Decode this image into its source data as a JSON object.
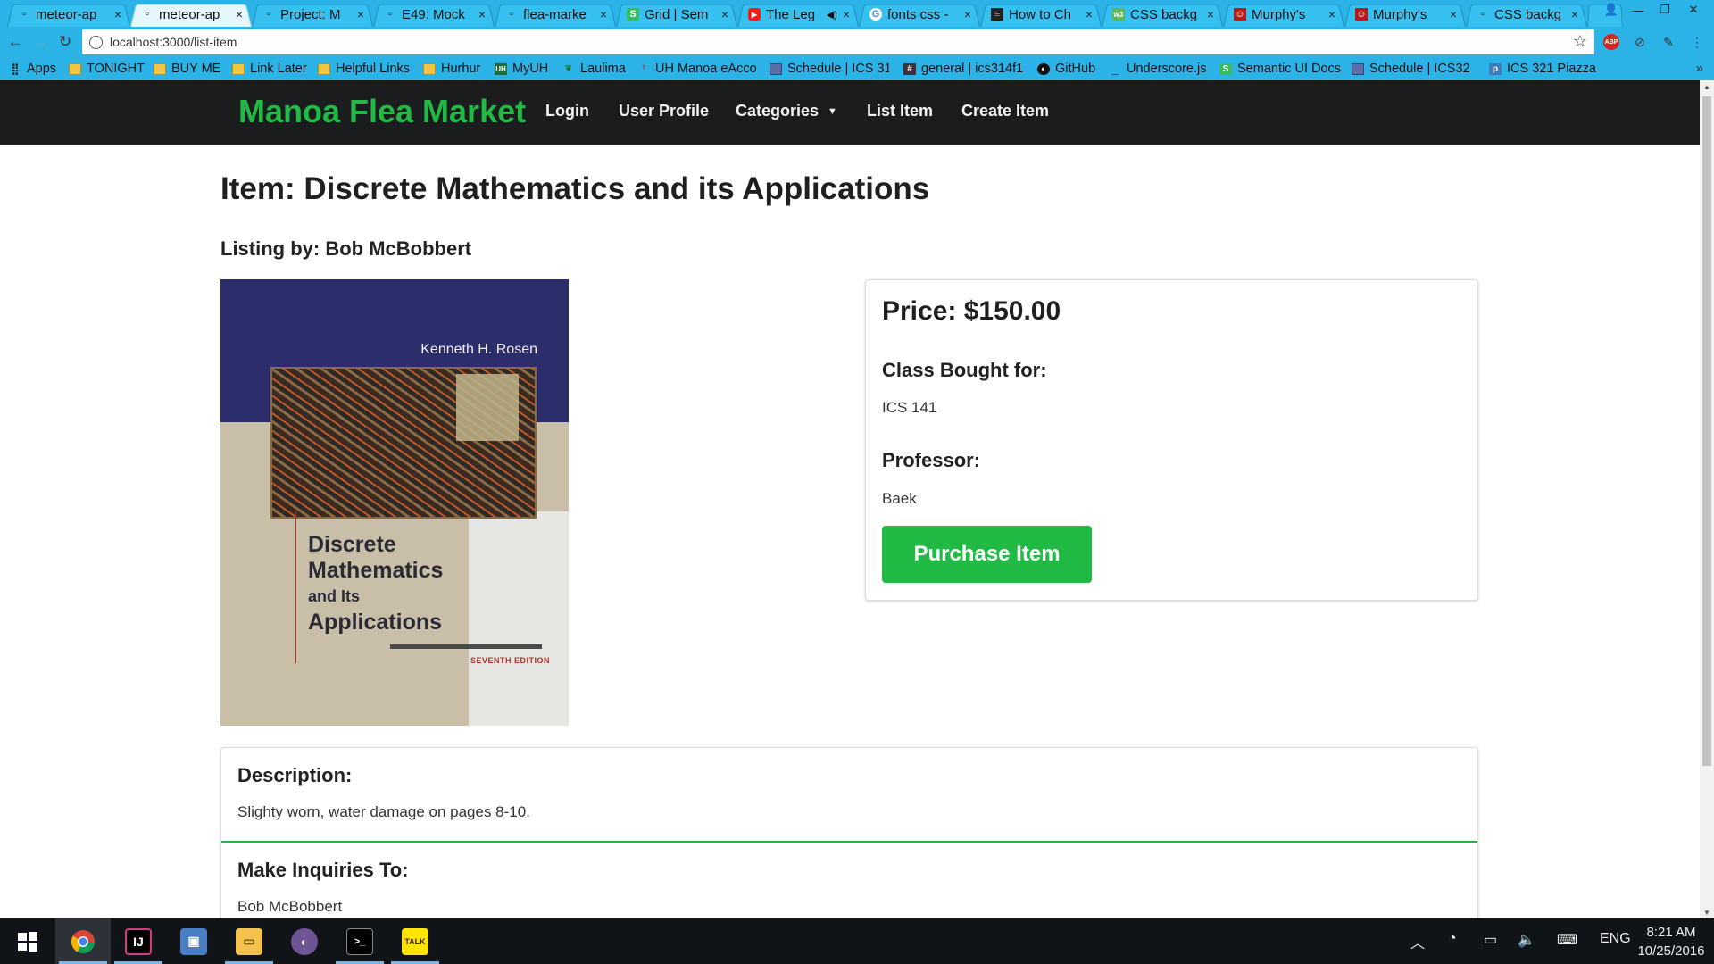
{
  "browser": {
    "tabs": [
      {
        "title": "meteor-ap",
        "icon": "page-icon",
        "active": false
      },
      {
        "title": "meteor-ap",
        "icon": "page-icon",
        "active": true
      },
      {
        "title": "Project: M",
        "icon": "page-icon",
        "active": false
      },
      {
        "title": "E49: Mock",
        "icon": "page-icon",
        "active": false
      },
      {
        "title": "flea-marke",
        "icon": "page-icon",
        "active": false
      },
      {
        "title": "Grid | Sem",
        "icon": "semantic-icon",
        "active": false
      },
      {
        "title": "The Leg",
        "icon": "youtube-icon",
        "active": false
      },
      {
        "title": "fonts css -",
        "icon": "google-icon",
        "active": false
      },
      {
        "title": "How to Ch",
        "icon": "stackoverflow-icon",
        "active": false
      },
      {
        "title": "CSS backg",
        "icon": "w3schools-icon",
        "active": false
      },
      {
        "title": "Murphy's",
        "icon": "murphy-icon",
        "active": false
      },
      {
        "title": "Murphy's",
        "icon": "murphy-icon",
        "active": false
      },
      {
        "title": "CSS backg",
        "icon": "page-icon",
        "active": false
      }
    ],
    "url": "localhost:3000/list-item",
    "bookmarks": [
      {
        "label": "Apps",
        "icon": "apps-grid-icon"
      },
      {
        "label": "TONIGHT",
        "icon": "folder-icon"
      },
      {
        "label": "BUY ME",
        "icon": "folder-icon"
      },
      {
        "label": "Link Later",
        "icon": "folder-icon"
      },
      {
        "label": "Helpful Links",
        "icon": "folder-icon"
      },
      {
        "label": "Hurhur",
        "icon": "folder-icon"
      },
      {
        "label": "MyUH",
        "icon": "uh-icon"
      },
      {
        "label": "Laulima",
        "icon": "laulima-icon"
      },
      {
        "label": "UH Manoa eAcco",
        "icon": "uh-eacct-icon"
      },
      {
        "label": "Schedule | ICS 31",
        "icon": "page-icon"
      },
      {
        "label": "general | ics314f1",
        "icon": "slack-icon"
      },
      {
        "label": "GitHub",
        "icon": "github-icon"
      },
      {
        "label": "Underscore.js",
        "icon": "underscore-icon"
      },
      {
        "label": "Semantic UI Docs",
        "icon": "semantic-icon"
      },
      {
        "label": "Schedule | ICS32",
        "icon": "page-icon"
      },
      {
        "label": "ICS 321 Piazza",
        "icon": "piazza-icon"
      }
    ]
  },
  "site": {
    "brand": "Manoa Flea Market",
    "nav": {
      "login": "Login",
      "profile": "User Profile",
      "categories": "Categories",
      "list_item": "List Item",
      "create_item": "Create Item"
    }
  },
  "item": {
    "title": "Item: Discrete Mathematics and its Applications",
    "listing_by": "Listing by: Bob McBobbert",
    "price": "Price: $150.00",
    "class_label": "Class Bought for:",
    "class_value": "ICS 141",
    "professor_label": "Professor:",
    "professor_value": "Baek",
    "purchase_button": "Purchase Item",
    "description_label": "Description:",
    "description_value": "Slighty worn, water damage on pages 8-10.",
    "inquiries_label": "Make Inquiries To:",
    "inquiries_value": "Bob McBobbert",
    "cover": {
      "author": "Kenneth H. Rosen",
      "title_line1": "Discrete",
      "title_line2": "Mathematics",
      "title_line3": "and Its",
      "title_line4": "Applications",
      "edition": "SEVENTH EDITION"
    }
  },
  "taskbar": {
    "apps": [
      "windows-start-icon",
      "chrome-icon",
      "intellij-icon",
      "box-icon",
      "file-explorer-icon",
      "github-desktop-icon",
      "terminal-icon",
      "kakaotalk-icon"
    ],
    "language": "ENG",
    "time": "8:21 AM",
    "date": "10/25/2016"
  },
  "colors": {
    "brand_green": "#21ba45",
    "navbar_bg": "#1b1c1d",
    "chrome_blue": "#2bb3e8"
  }
}
